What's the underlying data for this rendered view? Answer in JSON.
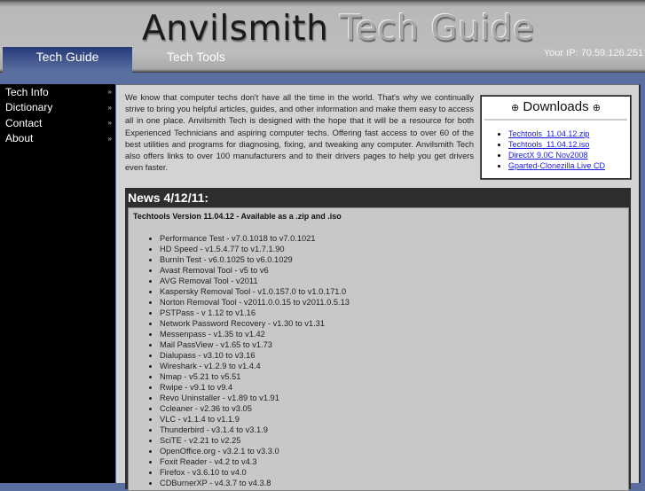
{
  "header": {
    "title_part1": "Anvilsmith",
    "title_part2": "Tech Guide",
    "tabs": [
      {
        "label": "Tech Guide",
        "active": true
      },
      {
        "label": "Tech Tools",
        "active": false
      }
    ],
    "ip_text": "Your IP: 70.59.126.251"
  },
  "sidebar": {
    "items": [
      {
        "label": "Tech Info",
        "arrow": "»"
      },
      {
        "label": "Dictionary",
        "arrow": "»"
      },
      {
        "label": "Contact",
        "arrow": "»"
      },
      {
        "label": "About",
        "arrow": "»"
      }
    ]
  },
  "intro": {
    "text": "We know that computer techs don't have all the time in the world. That's why we continually strive to bring you helpful articles, guides, and other information and make them easy to access all in one place. Anvilsmith Tech is designed with the hope that it will be a resource for both Experienced Technicians and aspiring computer techs. Offering fast access to over 60 of the best utilities and programs for diagnosing, fixing, and tweaking any computer. Anvilsmith Tech also offers links to over 100 manufacturers and to their drivers pages to help you get drivers even faster."
  },
  "downloads": {
    "title": "Downloads",
    "icon": "⊕",
    "links": [
      "Techtools_11.04.12.zip",
      "Techtools_11.04.12.iso",
      "DirectX 9.0C Nov2008",
      "Gparted-Clonezilla Live CD"
    ]
  },
  "news": {
    "title": "News 4/12/11:",
    "headline": "Techtools Version 11.04.12 - Available as a .zip and .iso",
    "changes": [
      "Performance Test - v7.0.1018 to v7.0.1021",
      "HD Speed - v1.5.4.77 to v1.7.1.90",
      "BurnIn Test - v6.0.1025 to v6.0.1029",
      "Avast Removal Tool - v5 to v6",
      "AVG Removal Tool - v2011",
      "Kaspersky Removal Tool - v1.0.157.0 to v1.0.171.0",
      "Norton Removal Tool - v2011.0.0.15 to v2011.0.5.13",
      "PSTPass - v 1.12 to v1.16",
      "Network Password Recovery - v1.30 to v1.31",
      "Messenpass - v1.35 to v1.42",
      "Mail PassView - v1.65 to v1.73",
      "Dialupass - v3.10 to v3.16",
      "Wireshark - v1.2.9 to v1.4.4",
      "Nmap - v5.21 to v5.51",
      "Rwipe - v9.1 to v9.4",
      "Revo Uninstaller - v1.89 to v1.91",
      "Ccleaner - v2.36 to v3.05",
      "VLC - v1.1.4 to v1.1.9",
      "Thunderbird - v3.1.4 to v3.1.9",
      "SciTE - v2.21 to v2.25",
      "OpenOffice.org - v3.2.1 to v3.3.0",
      "Foxit Reader - v4.2 to v4.3",
      "Firefox - v3.6.10 to v4.0",
      "CDBurnerXP - v4.3.7 to v4.3.8"
    ]
  }
}
